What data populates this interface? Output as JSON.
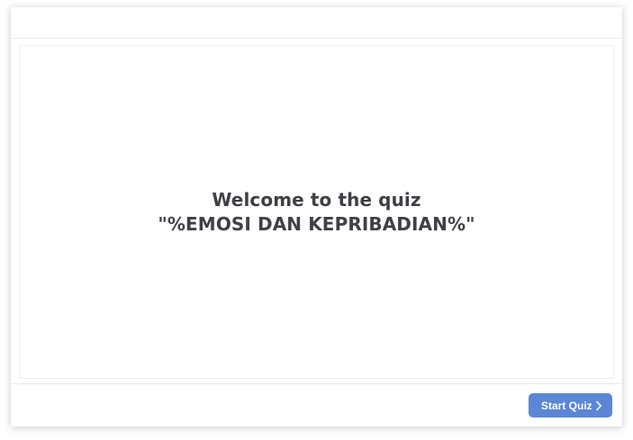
{
  "welcome": {
    "line1": "Welcome to the quiz",
    "line2": "\"%EMOSI DAN KEPRIBADIAN%\""
  },
  "footer": {
    "start_label": "Start Quiz",
    "start_icon": "chevron-right-icon"
  },
  "colors": {
    "button": "#5b86d6",
    "title_text": "#3f3f46",
    "border": "#ececec"
  }
}
